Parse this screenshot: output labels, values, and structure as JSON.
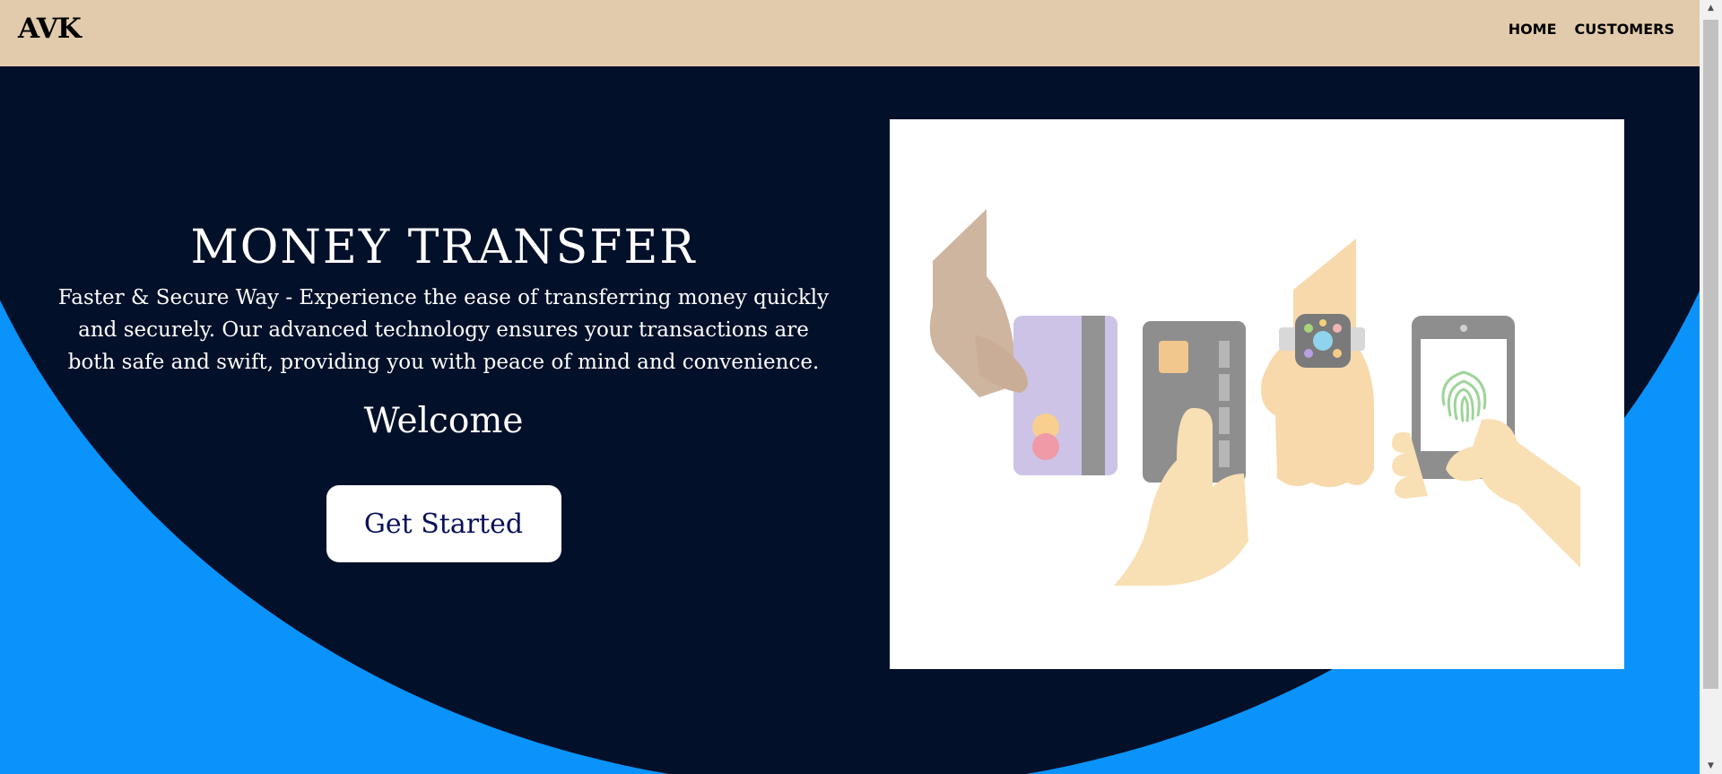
{
  "header": {
    "logo": "AVK",
    "nav": [
      {
        "label": "HOME"
      },
      {
        "label": "CUSTOMERS"
      }
    ]
  },
  "hero": {
    "title": "MONEY TRANSFER",
    "subtitle": "Faster & Secure Way - Experience the ease of transferring money quickly and securely. Our advanced technology ensures your transactions are both safe and swift, providing you with peace of mind and convenience.",
    "welcome": "Welcome",
    "cta_label": "Get Started"
  },
  "colors": {
    "header_bg": "#e2cbac",
    "hero_dark": "#03102a",
    "accent_blue": "#0a93fb",
    "button_text": "#0a0f5a"
  },
  "icons": {
    "scroll_up": "scroll-up-arrow-icon",
    "scroll_down": "scroll-down-arrow-icon"
  }
}
